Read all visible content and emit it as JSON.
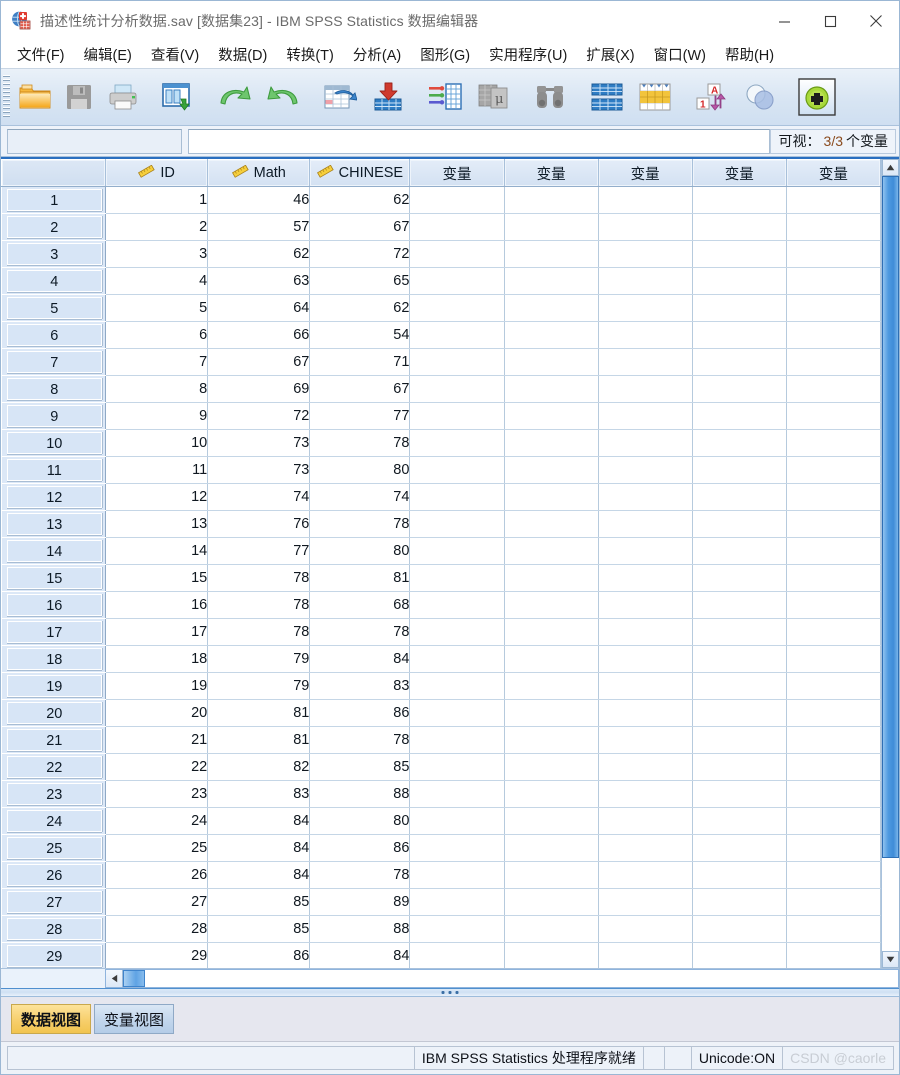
{
  "window": {
    "title": "描述性统计分析数据.sav [数据集23] - IBM SPSS Statistics 数据编辑器",
    "icon": "spss-app-icon",
    "minimize_label": "最小化",
    "maximize_label": "最大化",
    "close_label": "关闭"
  },
  "menu": {
    "items": [
      {
        "label": "文件(F)",
        "mnemonic": "F"
      },
      {
        "label": "编辑(E)",
        "mnemonic": "E"
      },
      {
        "label": "查看(V)",
        "mnemonic": "V"
      },
      {
        "label": "数据(D)",
        "mnemonic": "D"
      },
      {
        "label": "转换(T)",
        "mnemonic": "T"
      },
      {
        "label": "分析(A)",
        "mnemonic": "A"
      },
      {
        "label": "图形(G)",
        "mnemonic": "G"
      },
      {
        "label": "实用程序(U)",
        "mnemonic": "U"
      },
      {
        "label": "扩展(X)",
        "mnemonic": "X"
      },
      {
        "label": "窗口(W)",
        "mnemonic": "W"
      },
      {
        "label": "帮助(H)",
        "mnemonic": "H"
      }
    ]
  },
  "toolbar": {
    "buttons": [
      {
        "name": "open-file-icon",
        "tooltip": "打开数据文档"
      },
      {
        "name": "save-file-icon",
        "tooltip": "保存此文档"
      },
      {
        "name": "print-icon",
        "tooltip": "打印"
      },
      {
        "name": "recall-dialogs-icon",
        "tooltip": "调用最近使用的对话框"
      },
      {
        "name": "undo-icon",
        "tooltip": "撤销"
      },
      {
        "name": "redo-icon",
        "tooltip": "重做"
      },
      {
        "name": "goto-case-icon",
        "tooltip": "转至个案"
      },
      {
        "name": "goto-variable-icon",
        "tooltip": "转至变量"
      },
      {
        "name": "variables-icon",
        "tooltip": "变量"
      },
      {
        "name": "descriptives-icon",
        "tooltip": "运行描述统计"
      },
      {
        "name": "find-icon",
        "tooltip": "查找"
      },
      {
        "name": "insert-case-icon",
        "tooltip": "插入个案"
      },
      {
        "name": "insert-variable-icon",
        "tooltip": "插入变量"
      },
      {
        "name": "value-labels-icon",
        "tooltip": "值标签"
      },
      {
        "name": "split-file-icon",
        "tooltip": "拆分文件"
      },
      {
        "name": "weight-cases-icon",
        "tooltip": "个案加权"
      }
    ]
  },
  "cell_reference": {
    "ref_value": "",
    "ref_placeholder": "",
    "value_value": "",
    "value_placeholder": ""
  },
  "visible_variables": {
    "prefix": "可视：",
    "count": "3/3",
    "suffix": "个变量"
  },
  "grid": {
    "columns": [
      {
        "name": "ID",
        "measure_icon": "scale-ruler-icon",
        "has_icon": true
      },
      {
        "name": "Math",
        "measure_icon": "scale-ruler-icon",
        "has_icon": true
      },
      {
        "name": "CHINESE",
        "measure_icon": "scale-ruler-icon",
        "has_icon": true
      },
      {
        "name": "变量",
        "has_icon": false
      },
      {
        "name": "变量",
        "has_icon": false
      },
      {
        "name": "变量",
        "has_icon": false
      },
      {
        "name": "变量",
        "has_icon": false
      },
      {
        "name": "变量",
        "has_icon": false
      }
    ],
    "rows": [
      {
        "n": "1",
        "ID": "1",
        "Math": "46",
        "CHINESE": "62"
      },
      {
        "n": "2",
        "ID": "2",
        "Math": "57",
        "CHINESE": "67"
      },
      {
        "n": "3",
        "ID": "3",
        "Math": "62",
        "CHINESE": "72"
      },
      {
        "n": "4",
        "ID": "4",
        "Math": "63",
        "CHINESE": "65"
      },
      {
        "n": "5",
        "ID": "5",
        "Math": "64",
        "CHINESE": "62"
      },
      {
        "n": "6",
        "ID": "6",
        "Math": "66",
        "CHINESE": "54"
      },
      {
        "n": "7",
        "ID": "7",
        "Math": "67",
        "CHINESE": "71"
      },
      {
        "n": "8",
        "ID": "8",
        "Math": "69",
        "CHINESE": "67"
      },
      {
        "n": "9",
        "ID": "9",
        "Math": "72",
        "CHINESE": "77"
      },
      {
        "n": "10",
        "ID": "10",
        "Math": "73",
        "CHINESE": "78"
      },
      {
        "n": "11",
        "ID": "11",
        "Math": "73",
        "CHINESE": "80"
      },
      {
        "n": "12",
        "ID": "12",
        "Math": "74",
        "CHINESE": "74"
      },
      {
        "n": "13",
        "ID": "13",
        "Math": "76",
        "CHINESE": "78"
      },
      {
        "n": "14",
        "ID": "14",
        "Math": "77",
        "CHINESE": "80"
      },
      {
        "n": "15",
        "ID": "15",
        "Math": "78",
        "CHINESE": "81"
      },
      {
        "n": "16",
        "ID": "16",
        "Math": "78",
        "CHINESE": "68"
      },
      {
        "n": "17",
        "ID": "17",
        "Math": "78",
        "CHINESE": "78"
      },
      {
        "n": "18",
        "ID": "18",
        "Math": "79",
        "CHINESE": "84"
      },
      {
        "n": "19",
        "ID": "19",
        "Math": "79",
        "CHINESE": "83"
      },
      {
        "n": "20",
        "ID": "20",
        "Math": "81",
        "CHINESE": "86"
      },
      {
        "n": "21",
        "ID": "21",
        "Math": "81",
        "CHINESE": "78"
      },
      {
        "n": "22",
        "ID": "22",
        "Math": "82",
        "CHINESE": "85"
      },
      {
        "n": "23",
        "ID": "23",
        "Math": "83",
        "CHINESE": "88"
      },
      {
        "n": "24",
        "ID": "24",
        "Math": "84",
        "CHINESE": "80"
      },
      {
        "n": "25",
        "ID": "25",
        "Math": "84",
        "CHINESE": "86"
      },
      {
        "n": "26",
        "ID": "26",
        "Math": "84",
        "CHINESE": "78"
      },
      {
        "n": "27",
        "ID": "27",
        "Math": "85",
        "CHINESE": "89"
      },
      {
        "n": "28",
        "ID": "28",
        "Math": "85",
        "CHINESE": "88"
      },
      {
        "n": "29",
        "ID": "29",
        "Math": "86",
        "CHINESE": "84"
      }
    ]
  },
  "view_tabs": [
    {
      "label": "数据视图",
      "active": true
    },
    {
      "label": "变量视图",
      "active": false
    }
  ],
  "statusbar": {
    "message": "IBM SPSS Statistics 处理程序就绪",
    "unicode": "Unicode:ON",
    "watermark": "CSDN @caorle"
  },
  "colors": {
    "accent": "#2a6fc0",
    "header_blue": "#d3e1f2",
    "row_head": "#dce8f7",
    "active_tab": "#f7cf6c",
    "count_text": "#8a4b1e"
  }
}
